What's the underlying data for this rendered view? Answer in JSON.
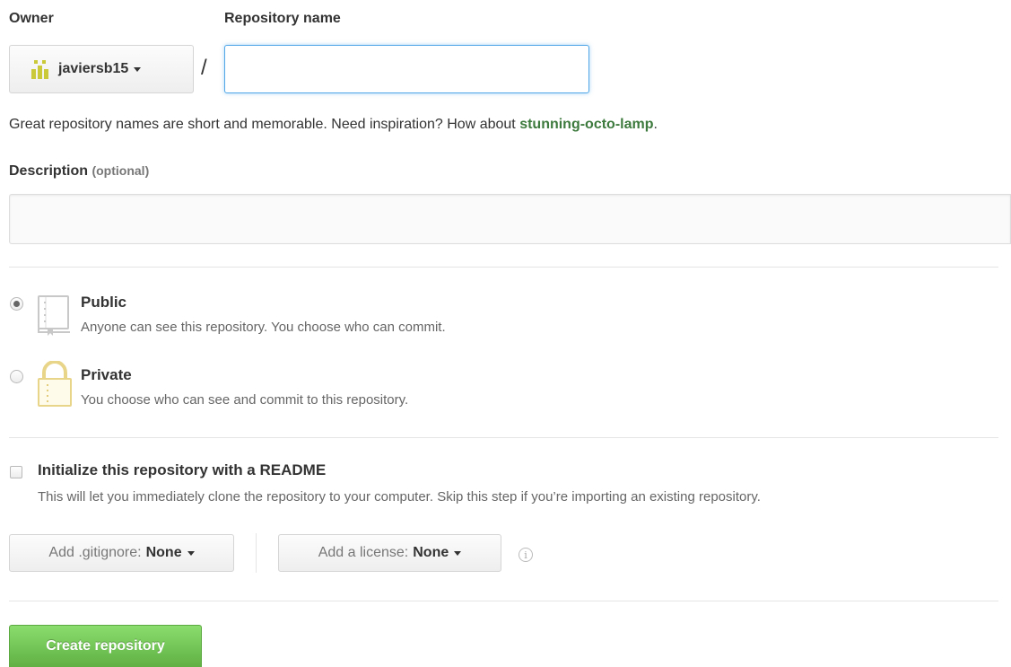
{
  "owner": {
    "label": "Owner",
    "value": "javiersb15"
  },
  "repo_name": {
    "label": "Repository name",
    "value": ""
  },
  "slash": "/",
  "hint": {
    "prefix": "Great repository names are short and memorable. Need inspiration? How about ",
    "suggestion": "stunning-octo-lamp",
    "suffix": "."
  },
  "description": {
    "label": "Description",
    "optional": "(optional)",
    "value": ""
  },
  "visibility": {
    "selected": "public",
    "public": {
      "title": "Public",
      "desc": "Anyone can see this repository. You choose who can commit.",
      "icon": "repo-book-icon"
    },
    "private": {
      "title": "Private",
      "desc": "You choose who can see and commit to this repository.",
      "icon": "lock-icon"
    }
  },
  "readme": {
    "title": "Initialize this repository with a README",
    "desc": "This will let you immediately clone the repository to your computer. Skip this step if you’re importing an existing repository.",
    "checked": false
  },
  "gitignore": {
    "prefix": "Add .gitignore:",
    "value": "None"
  },
  "license": {
    "prefix": "Add a license:",
    "value": "None"
  },
  "info_icon_glyph": "i",
  "create_button": "Create repository",
  "colors": {
    "accent_blue": "#51a7e8",
    "suggestion_green": "#3d7a3d",
    "create_green": "#60b044",
    "lock_yellow": "#e9d58a"
  }
}
